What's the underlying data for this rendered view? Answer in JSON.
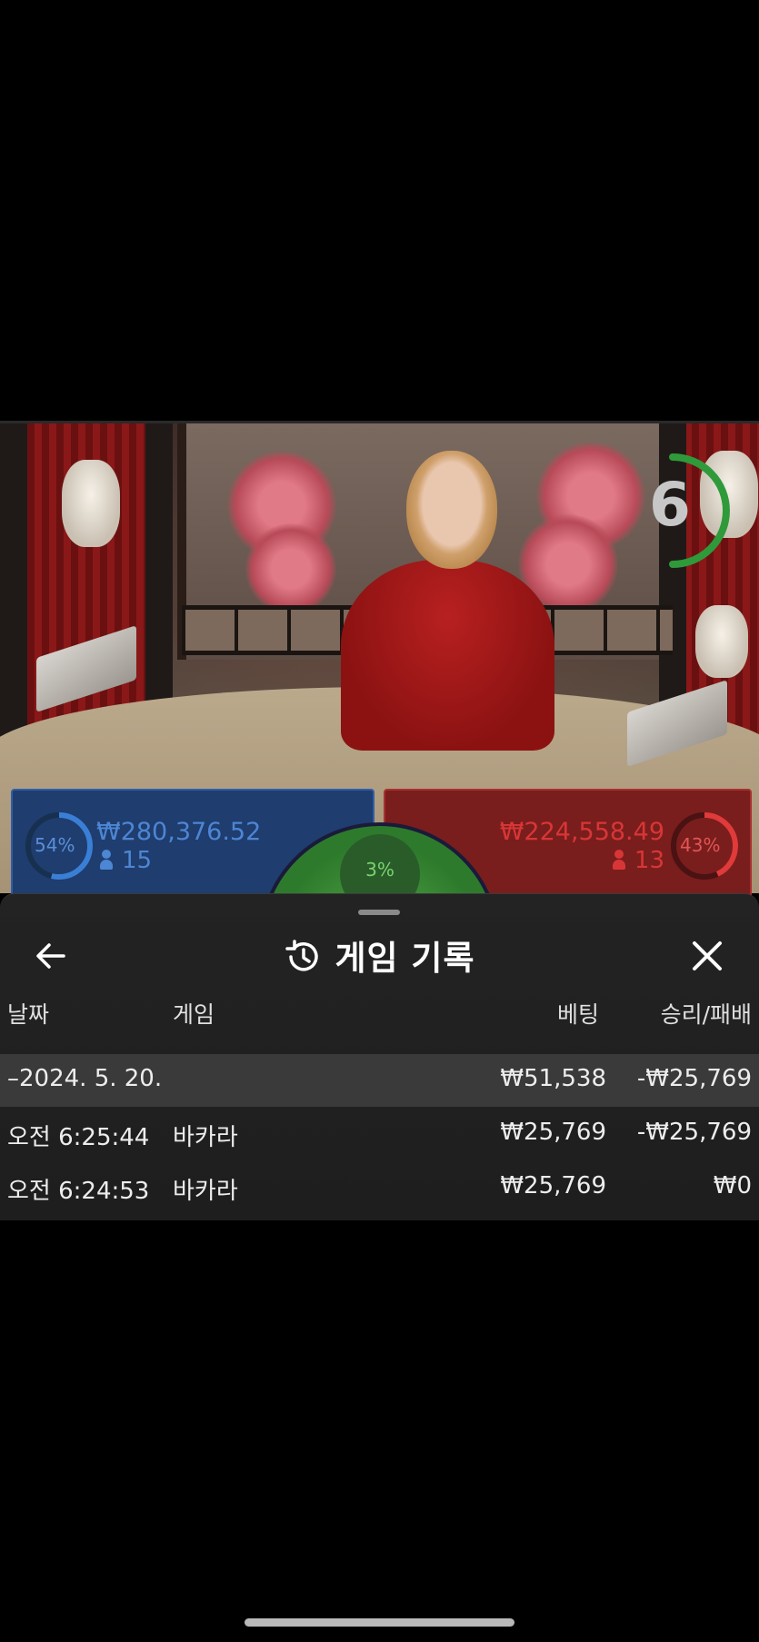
{
  "game": {
    "countdown": "6",
    "player": {
      "percent": "54%",
      "amount": "₩280,376.52",
      "count": "15",
      "color": "#2f6fc0"
    },
    "banker": {
      "percent": "43%",
      "amount": "₩224,558.49",
      "count": "13",
      "color": "#d02a2a"
    },
    "tie": {
      "percent": "3%",
      "color": "#4caf3e"
    }
  },
  "sheet": {
    "title": "게임 기록",
    "title_icon": "history-icon",
    "back_icon": "arrow-left-icon",
    "close_icon": "close-icon",
    "columns": {
      "date": "날짜",
      "game": "게임",
      "bet": "베팅",
      "result": "승리/패배"
    },
    "group": {
      "date": "2024. 5. 20.",
      "bet": "₩51,538",
      "result": "-₩25,769"
    },
    "rows": [
      {
        "time": "오전 6:25:44",
        "game": "바카라",
        "bet": "₩25,769",
        "result": "-₩25,769"
      },
      {
        "time": "오전 6:24:53",
        "game": "바카라",
        "bet": "₩25,769",
        "result": "₩0"
      }
    ]
  }
}
